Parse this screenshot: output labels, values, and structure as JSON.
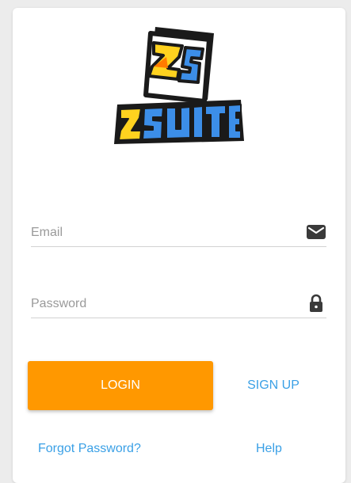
{
  "app": {
    "logo_icon": "zsuite-logo",
    "logo_text": "ZSUITE",
    "logo_monogram": "ZS"
  },
  "form": {
    "email": {
      "placeholder": "Email",
      "value": "",
      "icon": "envelope-icon"
    },
    "password": {
      "placeholder": "Password",
      "value": "",
      "icon": "lock-icon"
    }
  },
  "actions": {
    "login_label": "LOGIN",
    "signup_label": "SIGN UP",
    "forgot_label": "Forgot Password?",
    "help_label": "Help"
  },
  "colors": {
    "primary": "#ff9800",
    "link": "#3aa0e6",
    "icon": "#3a3a3a"
  }
}
